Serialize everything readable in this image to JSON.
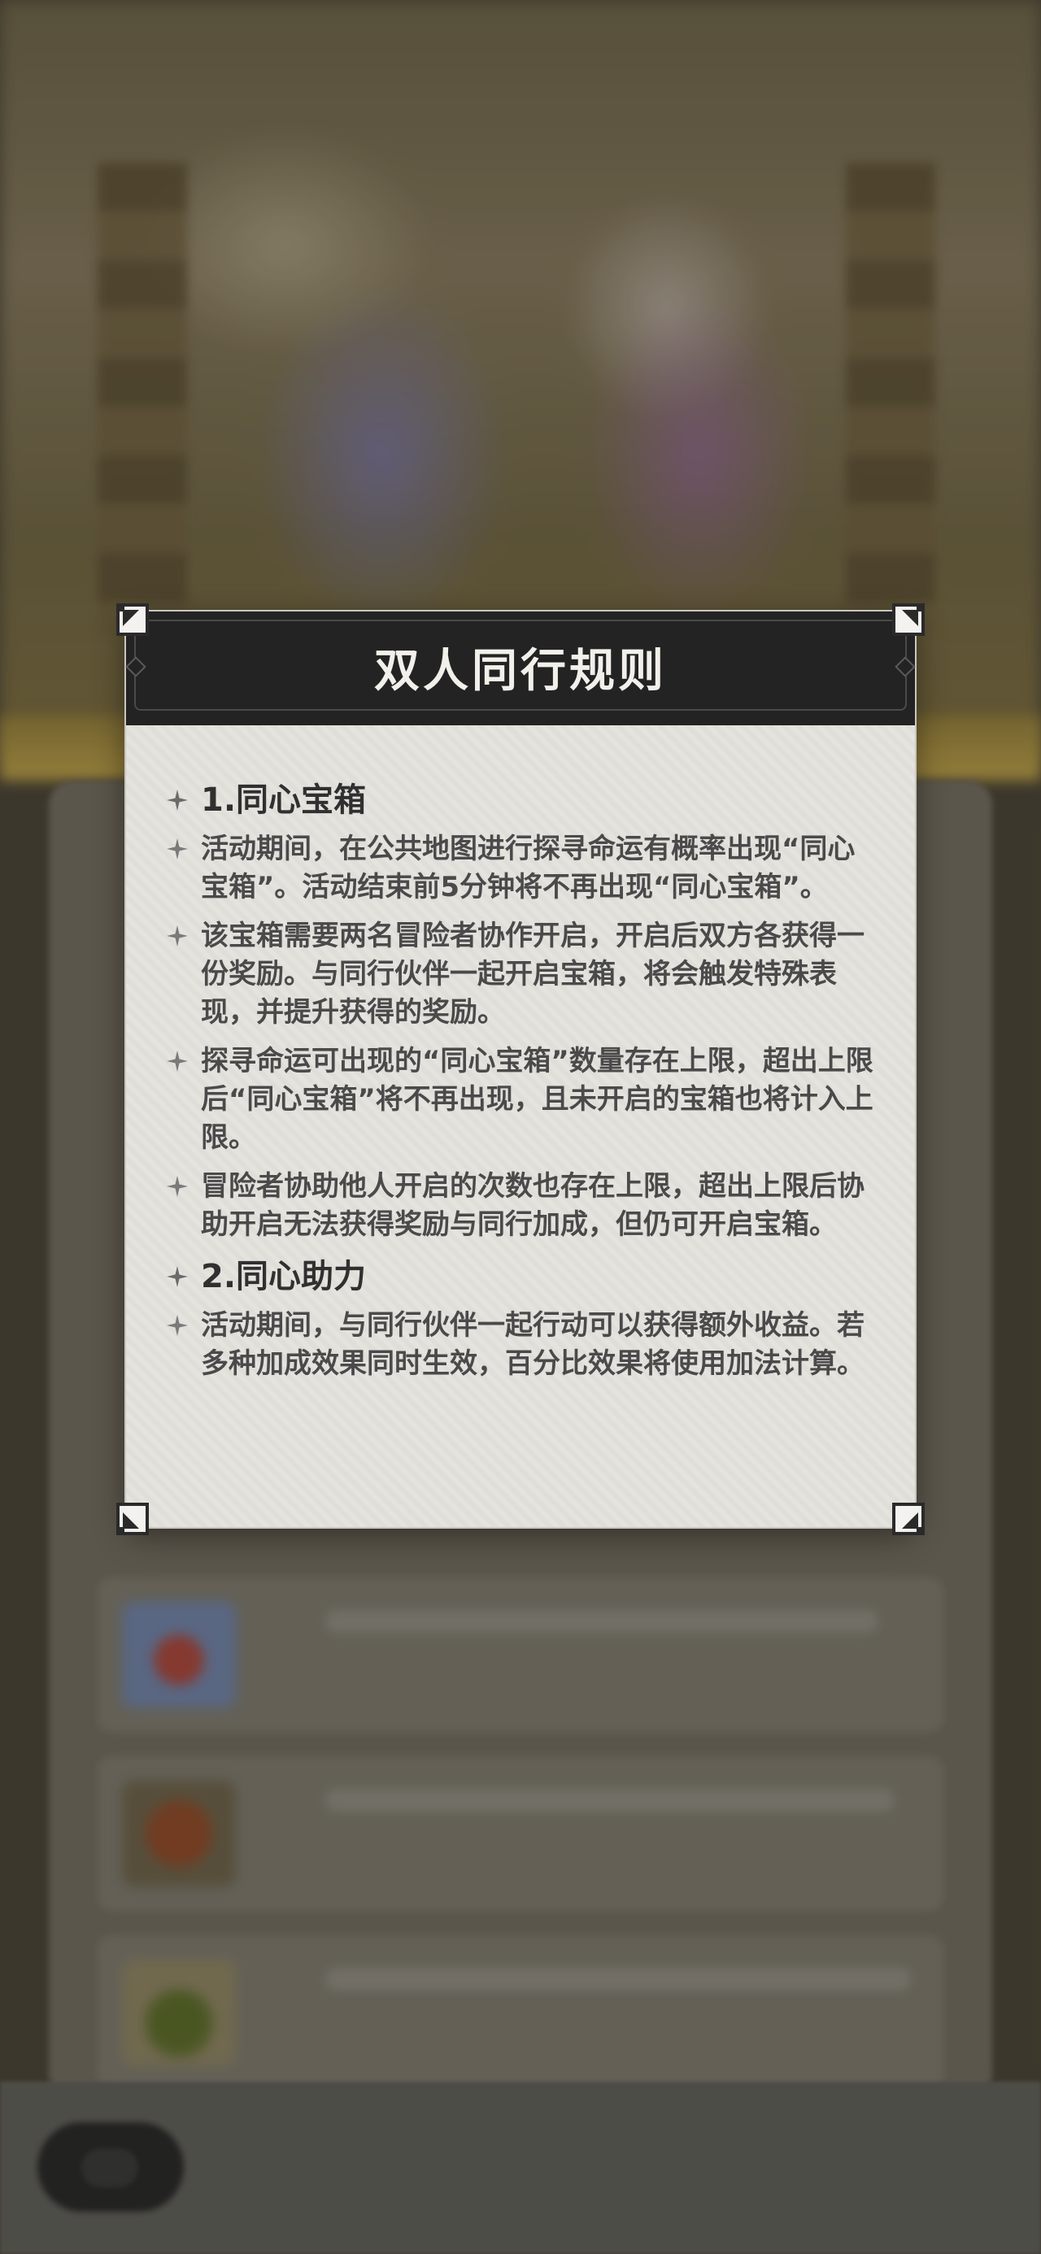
{
  "dialog": {
    "title": "双人同行规则",
    "sections": [
      {
        "heading": "1.同心宝箱",
        "paragraphs": [
          "活动期间，在公共地图进行探寻命运有概率出现“同心宝箱”。活动结束前5分钟将不再出现“同心宝箱”。",
          "该宝箱需要两名冒险者协作开启，开启后双方各获得一份奖励。与同行伙伴一起开启宝箱，将会触发特殊表现，并提升获得的奖励。",
          "探寻命运可出现的“同心宝箱”数量存在上限，超出上限后“同心宝箱”将不再出现，且未开启的宝箱也将计入上限。",
          "冒险者协助他人开启的次数也存在上限，超出上限后协助开启无法获得奖励与同行加成，但仍可开启宝箱。"
        ]
      },
      {
        "heading": "2.同心助力",
        "paragraphs": [
          "活动期间，与同行伙伴一起行动可以获得额外收益。若多种加成效果同时生效，百分比效果将使用加法计算。"
        ]
      }
    ]
  },
  "icons": {
    "bullet": "sparkle-star-icon",
    "corner": "ornate-corner-icon"
  },
  "colors": {
    "header_bg": "#232323",
    "panel_bg": "#e4e2dd",
    "title_text": "#f2f0ea",
    "body_text": "#4a4a4a"
  }
}
